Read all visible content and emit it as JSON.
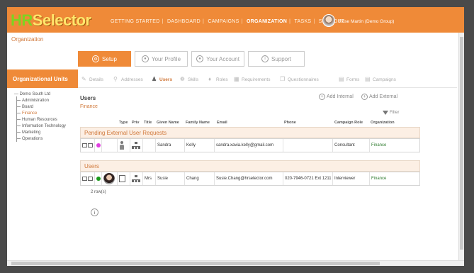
{
  "header": {
    "logo_hr": "HR",
    "logo_sel": "Selector",
    "nav": [
      "GETTING STARTED",
      "DASHBOARD",
      "CAMPAIGNS",
      "ORGANIZATION",
      "TASKS",
      "SIGN-OUT"
    ],
    "active_nav": "ORGANIZATION",
    "user": "Rose Martin (Demo Group)"
  },
  "page_title": "Organization",
  "tabs": [
    {
      "label": "Setup",
      "icon": "wrench-icon"
    },
    {
      "label": "Your Profile",
      "icon": "user-icon"
    },
    {
      "label": "Your Account",
      "icon": "user-icon"
    },
    {
      "label": "Support",
      "icon": "info-icon"
    }
  ],
  "left_header": "Organizational Units",
  "subnav": [
    "Details",
    "Addresses",
    "Users",
    "Skills",
    "Roles",
    "Requirements",
    "Questionnaires",
    "Forms",
    "Campaigns"
  ],
  "subnav_active": "Users",
  "tree": {
    "root": "Demo South Ltd",
    "children": [
      "Administration",
      "Board",
      "Finance",
      "Human Resources",
      "Information Technology",
      "Marketing",
      "Operations"
    ],
    "selected": "Finance"
  },
  "section": {
    "title": "Users",
    "subtitle": "Finance",
    "add_internal": "Add Internal",
    "add_external": "Add External",
    "filter": "Filter"
  },
  "columns": [
    "Type",
    "Priv",
    "Title",
    "Given Name",
    "Family Name",
    "Email",
    "Phone",
    "Campaign Role",
    "Organization"
  ],
  "groups": {
    "pending": "Pending External User Requests",
    "users": "Users"
  },
  "pending_rows": [
    {
      "title": "",
      "given": "Sandra",
      "family": "Kelly",
      "email": "sandra.xavia.kelly@gmail.com",
      "phone": "",
      "role": "Consultant",
      "org": "Finance",
      "status_color": "#e040e0"
    }
  ],
  "user_rows": [
    {
      "title": "Mrs",
      "given": "Susie",
      "family": "Chang",
      "email": "Susie.Chang@hrselector.com",
      "phone": "020-7946-0721 Ext 1211",
      "role": "Interviewer",
      "org": "Finance",
      "status_color": "#1a9a1a"
    }
  ],
  "row_count": "2 row(s)"
}
